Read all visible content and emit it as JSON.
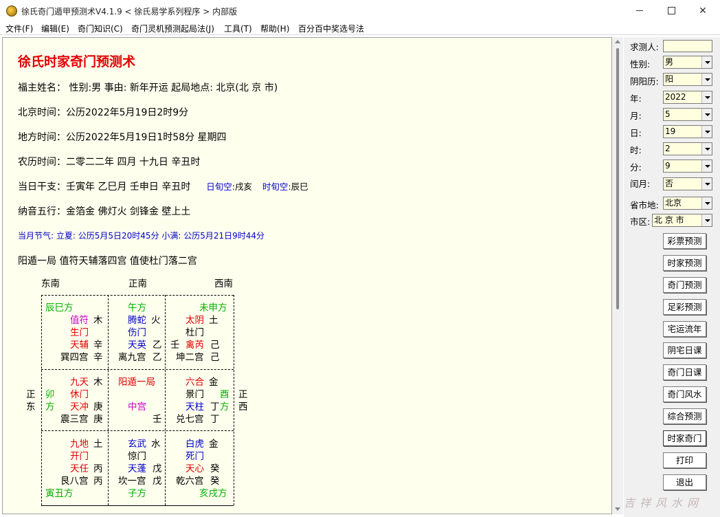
{
  "window": {
    "title": "徐氏奇门遁甲预测术V4.1.9  < 徐氏易学系列程序 > 内部版"
  },
  "menu": [
    "文件(F)",
    "编辑(E)",
    "奇门知识(C)",
    "奇门灵机预测起局法(J)",
    "工具(T)",
    "帮助(H)",
    "百分百中奖选号法"
  ],
  "report": {
    "heading": "徐氏时家奇门预测术",
    "line_owner": "福主姓名：   性别:男   事由: 新年开运    起局地点: 北京(北 京 市)",
    "line_beijing_time": "北京时间：公历2022年5月19日2时9分",
    "line_local_time": "地方时间：公历2022年5月19日1时58分  星期四",
    "line_lunar": "农历时间：二零二二年  四月  十九日  辛丑时",
    "line_ganzhi": "当日干支：壬寅年  乙巳月  壬申日  辛丑时",
    "day_void_label": "日旬空",
    "day_void": ":戌亥",
    "hour_void_label": "时旬空",
    "hour_void": ":辰巳",
    "line_nayin": "纳音五行：金箔金  佛灯火  剑锋金  壁上土",
    "line_solar_term": "当月节气: 立夏: 公历5月5日20时45分  小满: 公历5月21日9时44分",
    "line_ju": "阳遁一局  值符天辅落四宫  值使杜门落二宫"
  },
  "chart": {
    "dir_top": [
      "东南",
      "正南",
      "西南"
    ],
    "dir_left": [
      "正",
      "东"
    ],
    "dir_right": [
      "正",
      "西"
    ],
    "p4": {
      "corner": "辰巳方",
      "deity": "值符",
      "deity_el": "木",
      "gate": "生门",
      "star": "天辅",
      "star_stem": "辛",
      "palace": "巽四宫",
      "palace_stem": "辛"
    },
    "p9": {
      "corner": "午方",
      "deity": "腾蛇",
      "deity_el": "火",
      "gate": "伤门",
      "star": "天英",
      "star_stem": "乙",
      "palace": "离九宫",
      "palace_stem": "乙"
    },
    "p2": {
      "corner": "未申方",
      "deity": "太阴",
      "deity_el": "土",
      "gate": "杜门",
      "extra_stem": "壬",
      "star": "禽芮",
      "star_stem": "己",
      "palace": "坤二宫",
      "palace_stem": "己"
    },
    "p3": {
      "corner_a": "卯",
      "corner_b": "方",
      "deity": "九天",
      "deity_el": "木",
      "gate": "休门",
      "star": "天冲",
      "star_stem": "庚",
      "palace": "震三宫",
      "palace_stem": "庚"
    },
    "p5": {
      "title": "阳遁一局",
      "center": "中宫",
      "stem": "壬"
    },
    "p7": {
      "corner_a": "酉",
      "corner_b": "方",
      "deity": "六合",
      "deity_el": "金",
      "gate": "景门",
      "star": "天柱",
      "star_stem": "丁",
      "palace": "兑七宫",
      "palace_stem": "丁"
    },
    "p8": {
      "corner": "寅丑方",
      "deity": "九地",
      "deity_el": "土",
      "gate": "开门",
      "star": "天任",
      "star_stem": "丙",
      "palace": "艮八宫",
      "palace_stem": "丙"
    },
    "p1": {
      "corner": "子方",
      "deity": "玄武",
      "deity_el": "水",
      "gate": "惊门",
      "star": "天蓬",
      "star_stem": "戊",
      "palace": "坎一宫",
      "palace_stem": "戊"
    },
    "p6": {
      "corner": "亥戌方",
      "deity": "白虎",
      "deity_el": "金",
      "gate": "死门",
      "star": "天心",
      "star_stem": "癸",
      "palace": "乾六宫",
      "palace_stem": "癸"
    }
  },
  "side": {
    "asker_label": "求测人:",
    "asker_value": "",
    "gender_label": "性别:",
    "gender_value": "男",
    "calendar_label": "阴阳历:",
    "calendar_value": "阳",
    "year_label": "年:",
    "year_value": "2022",
    "month_label": "月:",
    "month_value": "5",
    "day_label": "日:",
    "day_value": "19",
    "hour_label": "时:",
    "hour_value": "2",
    "minute_label": "分:",
    "minute_value": "9",
    "leap_label": "闰月:",
    "leap_value": "否",
    "province_label": "省市地:",
    "province_value": "北京",
    "district_label": "市区:",
    "district_value": "北 京 市",
    "buttons": [
      "彩票预测",
      "时家预测",
      "奇门预测",
      "足彩预测",
      "宅运流年",
      "阴宅日课",
      "奇门日课",
      "奇门风水",
      "综合预测",
      "时家奇门",
      "打印",
      "退出"
    ],
    "watermark": "吉祥风水网"
  }
}
